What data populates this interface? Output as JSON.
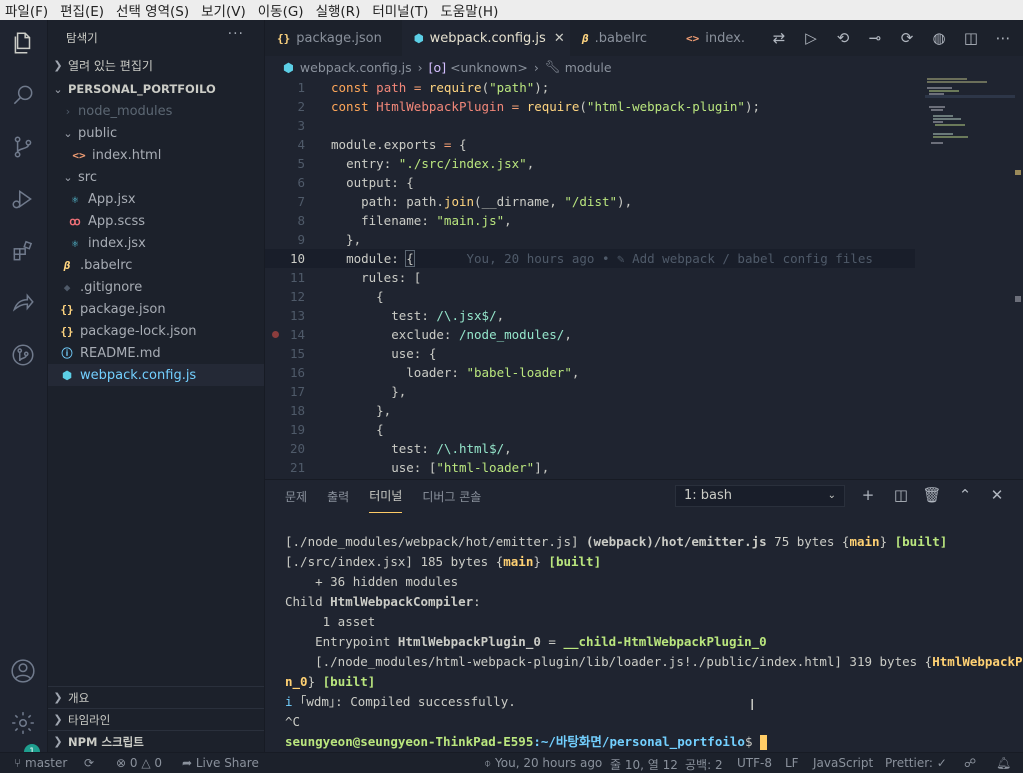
{
  "menu": [
    "파일(F)",
    "편집(E)",
    "선택 영역(S)",
    "보기(V)",
    "이동(G)",
    "실행(R)",
    "터미널(T)",
    "도움말(H)"
  ],
  "activity": {
    "badge": "1"
  },
  "sidebar": {
    "title": "탐색기",
    "more": "···",
    "open_editors": "열려 있는 편집기",
    "project": "PERSONAL_PORTFOILO",
    "tree": [
      {
        "label": "node_modules",
        "type": "folder",
        "icon": "chevron-right",
        "depth": 1
      },
      {
        "label": "public",
        "type": "folder",
        "icon": "chevron-down",
        "depth": 1
      },
      {
        "label": "index.html",
        "type": "html",
        "icon": "<>",
        "depth": 2
      },
      {
        "label": "src",
        "type": "folder",
        "icon": "chevron-down",
        "depth": 1
      },
      {
        "label": "App.jsx",
        "type": "react",
        "icon": "⚛",
        "depth": 2
      },
      {
        "label": "App.scss",
        "type": "sass",
        "icon": "ꝏ",
        "depth": 2
      },
      {
        "label": "index.jsx",
        "type": "react",
        "icon": "⚛",
        "depth": 2
      },
      {
        "label": ".babelrc",
        "type": "babel",
        "icon": "β",
        "depth": 1
      },
      {
        "label": ".gitignore",
        "type": "git",
        "icon": "◆",
        "depth": 1
      },
      {
        "label": "package.json",
        "type": "json",
        "icon": "{}",
        "depth": 1
      },
      {
        "label": "package-lock.json",
        "type": "json",
        "icon": "{}",
        "depth": 1
      },
      {
        "label": "README.md",
        "type": "info",
        "icon": "ⓘ",
        "depth": 1
      },
      {
        "label": "webpack.config.js",
        "type": "webpack",
        "icon": "⬢",
        "depth": 1
      }
    ],
    "outline": "개요",
    "timeline": "타임라인",
    "npm": "NPM 스크립트"
  },
  "tabs": [
    {
      "label": "package.json",
      "icon": "{}"
    },
    {
      "label": "webpack.config.js",
      "icon": "⬢"
    },
    {
      "label": ".babelrc",
      "icon": "β"
    },
    {
      "label": "index.",
      "icon": "<>"
    }
  ],
  "breadcrumb": {
    "file": "webpack.config.js",
    "scope": "<unknown>",
    "symbol": "module"
  },
  "code": {
    "line_numbers": [
      "1",
      "2",
      "3",
      "4",
      "5",
      "6",
      "7",
      "8",
      "9",
      "10",
      "11",
      "12",
      "13",
      "14",
      "15",
      "16",
      "17",
      "18",
      "19",
      "20",
      "21"
    ],
    "blame": "You, 20 hours ago • ✎ Add webpack / babel config files"
  },
  "panel": {
    "tabs": [
      "문제",
      "출력",
      "터미널",
      "디버그 콘솔"
    ],
    "active_tab": "터미널",
    "terminal_select": "1: bash",
    "lines": {
      "l1a": "[./node_modules/webpack/hot/emitter.js] ",
      "l1b": "(webpack)/hot/emitter.js",
      "l1c": " 75 bytes {",
      "l1d": "main",
      "l1e": "} ",
      "l1f": "[built]",
      "l2a": "[./src/index.jsx] 185 bytes {",
      "l2b": "main",
      "l2c": "} ",
      "l2d": "[built]",
      "l3": "    + 36 hidden modules",
      "l4a": "Child ",
      "l4b": "HtmlWebpackCompiler",
      "l4c": ":",
      "l5": "     1 asset",
      "l6a": "    Entrypoint ",
      "l6b": "HtmlWebpackPlugin_0",
      "l6c": " = ",
      "l6d": "__child-HtmlWebpackPlugin_0",
      "l7a": "    [./node_modules/html-webpack-plugin/lib/loader.js!./public/index.html] 319 bytes {",
      "l7b": "HtmlWebpackPlugi",
      "l8a": "n_0",
      "l8b": "} ",
      "l8c": "[built]",
      "l9a": "i ",
      "l9b": "｢wdm｣",
      "l9c": ": Compiled successfully.",
      "l10": "^C",
      "prompt_user": "seungyeon@seungyeon-ThinkPad-E595",
      "prompt_path": ":~/바탕화면/personal_portfoilo",
      "prompt_end": "$ "
    }
  },
  "status": {
    "branch": "master",
    "errors": "0",
    "warnings": "0",
    "liveshare": "Live Share",
    "blame": "You, 20 hours ago",
    "position": "줄 10, 열 12",
    "spaces": "공백: 2",
    "encoding": "UTF-8",
    "eol": "LF",
    "language": "JavaScript",
    "prettier": "Prettier: ✓"
  },
  "colors": {
    "background": "#1f2430",
    "accent": "#ffcc66",
    "sidebar": "#1c212b"
  }
}
